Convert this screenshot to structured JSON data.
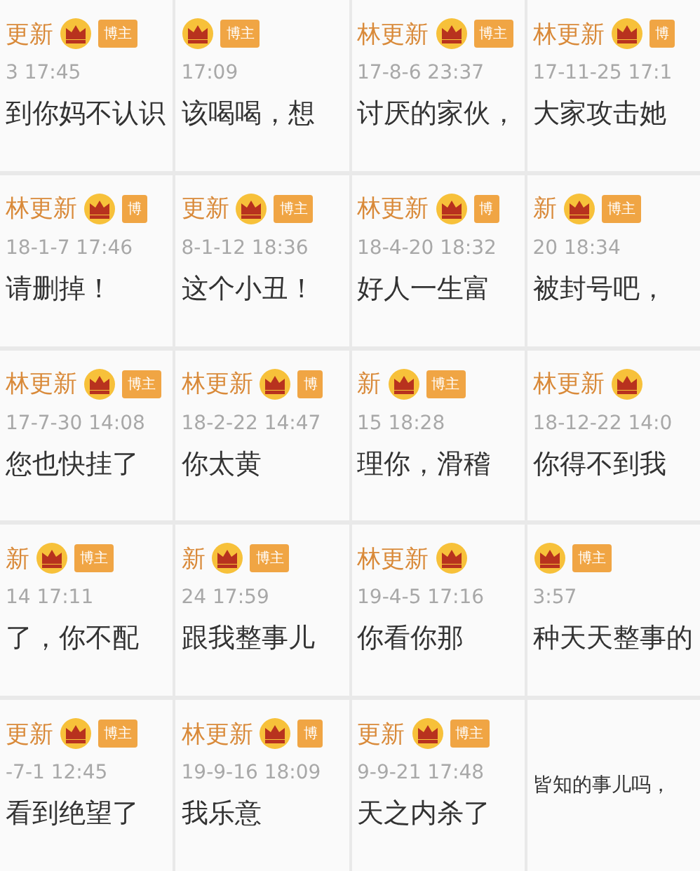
{
  "rows": [
    {
      "fragments": [
        {
          "name": "更新",
          "badge": "博主",
          "time": "3 17:45",
          "text": "到你妈不认识"
        },
        {
          "badge": "博主",
          "time": "17:09",
          "text": "该喝喝，想"
        },
        {
          "name": "林更新",
          "badge": "博主",
          "time": "17-8-6 23:37",
          "text": "讨厌的家伙，"
        },
        {
          "name": "林更新",
          "badge": "博",
          "time": "17-11-25 17:1",
          "text": "大家攻击她"
        }
      ]
    },
    {
      "fragments": [
        {
          "name": "林更新",
          "badge": "博",
          "time": "18-1-7 17:46",
          "text": "请删掉！"
        },
        {
          "name": "更新",
          "badge": "博主",
          "time": "8-1-12 18:36",
          "text": "这个小丑！"
        },
        {
          "name": "林更新",
          "badge": "博",
          "time": "18-4-20 18:32",
          "text": "好人一生富"
        },
        {
          "name": "新",
          "badge": "博主",
          "time": "20 18:34",
          "text": "被封号吧，"
        }
      ]
    },
    {
      "fragments": [
        {
          "name": "林更新",
          "badge": "博主",
          "time": "17-7-30 14:08",
          "text": "您也快挂了"
        },
        {
          "name": "林更新",
          "badge": "博",
          "time": "18-2-22 14:47",
          "text": "你太黄"
        },
        {
          "name": "新",
          "badge": "博主",
          "time": "15 18:28",
          "text": "理你，滑稽"
        },
        {
          "name": "林更新",
          "time": "18-12-22 14:0",
          "text": "你得不到我"
        }
      ]
    },
    {
      "fragments": [
        {
          "name": "新",
          "badge": "博主",
          "time": "14 17:11",
          "text": "了，你不配"
        },
        {
          "name": "新",
          "badge": "博主",
          "time": "24 17:59",
          "text": "跟我整事儿"
        },
        {
          "name": "林更新",
          "time": "19-4-5 17:16",
          "text": "你看你那"
        },
        {
          "badge": "博主",
          "time": "3:57",
          "text": "种天天整事的"
        }
      ]
    },
    {
      "fragments": [
        {
          "name": "更新",
          "badge": "博主",
          "time": "-7-1 12:45",
          "text": "看到绝望了"
        },
        {
          "name": "林更新",
          "badge": "博",
          "time": "19-9-16 18:09",
          "text": "我乐意"
        },
        {
          "name": "更新",
          "badge": "博主",
          "time": "9-9-21 17:48",
          "text": "天之内杀了"
        },
        {
          "text": "皆知的事儿吗，"
        }
      ]
    }
  ]
}
